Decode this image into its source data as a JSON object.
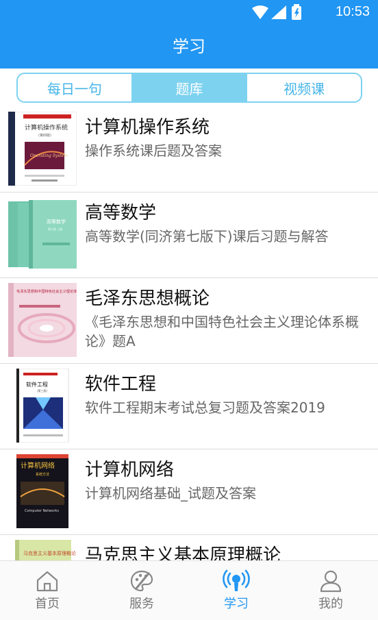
{
  "status_bar": {
    "time": "10:53"
  },
  "header": {
    "title": "学习"
  },
  "tabs": [
    {
      "label": "每日一句",
      "active": false
    },
    {
      "label": "题库",
      "active": true
    },
    {
      "label": "视频课",
      "active": false
    }
  ],
  "items": [
    {
      "title": "计算机操作系统",
      "desc": "操作系统课后题及答案"
    },
    {
      "title": "高等数学",
      "desc": "高等数学(同济第七版下)课后习题与解答"
    },
    {
      "title": "毛泽东思想概论",
      "desc": "《毛泽东思想和中国特色社会主义理论体系概论》题A"
    },
    {
      "title": "软件工程",
      "desc": "软件工程期末考试总复习题及答案2019"
    },
    {
      "title": "计算机网络",
      "desc": "计算机网络基础_试题及答案"
    },
    {
      "title": "马克思主义基本原理概论",
      "desc": ""
    }
  ],
  "covers": [
    {
      "title": "计算机操作系统",
      "subtitle": "(第四版)",
      "art": "Operating System"
    },
    {
      "title": "高等数学",
      "subtitle": "第七版 上册",
      "art": ""
    },
    {
      "title": "毛泽东思想和中国特色社会主义理论体系概论",
      "subtitle": "",
      "art": ""
    },
    {
      "title": "软件工程",
      "subtitle": "(第三版)",
      "art": ""
    },
    {
      "title": "计算机网络",
      "subtitle": "系统方法",
      "art": "Computer Networks"
    },
    {
      "title": "马克思主义基本原理概论",
      "subtitle": "",
      "art": ""
    }
  ],
  "bottom_nav": [
    {
      "label": "首页",
      "icon": "home-icon",
      "active": false
    },
    {
      "label": "服务",
      "icon": "palette-icon",
      "active": false
    },
    {
      "label": "学习",
      "icon": "broadcast-icon",
      "active": true
    },
    {
      "label": "我的",
      "icon": "user-icon",
      "active": false
    }
  ],
  "colors": {
    "primary": "#2196f3",
    "tab_accent": "#7dd2f0"
  }
}
